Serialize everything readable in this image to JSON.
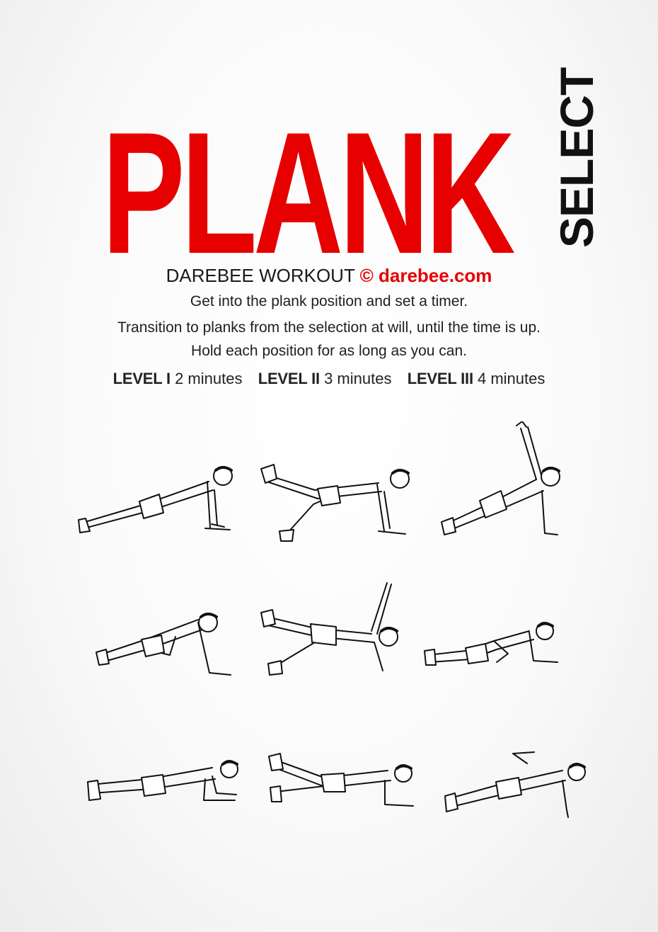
{
  "title": "PLANK",
  "subtitle": "SELECT",
  "brand": {
    "label": "DAREBEE WORKOUT",
    "copyright": "©",
    "site": "darebee.com"
  },
  "description": [
    "Get into the plank position and set a timer.",
    "Transition to planks from the selection at will, until the time is up.",
    "Hold each position for as long as you can."
  ],
  "levels": [
    {
      "label": "LEVEL I",
      "duration": "2 minutes"
    },
    {
      "label": "LEVEL II",
      "duration": "3 minutes"
    },
    {
      "label": "LEVEL III",
      "duration": "4 minutes"
    }
  ],
  "colors": {
    "accent": "#e60000",
    "text": "#1a1a1a"
  },
  "exercises": [
    {
      "icon": "high-plank-figure-icon"
    },
    {
      "icon": "high-plank-leg-raise-figure-icon"
    },
    {
      "icon": "side-plank-arm-raise-figure-icon"
    },
    {
      "icon": "plank-knee-to-elbow-figure-icon"
    },
    {
      "icon": "star-side-plank-figure-icon"
    },
    {
      "icon": "plank-knee-tuck-figure-icon"
    },
    {
      "icon": "forearm-plank-figure-icon"
    },
    {
      "icon": "forearm-plank-leg-raise-figure-icon"
    },
    {
      "icon": "forearm-side-plank-figure-icon"
    }
  ]
}
